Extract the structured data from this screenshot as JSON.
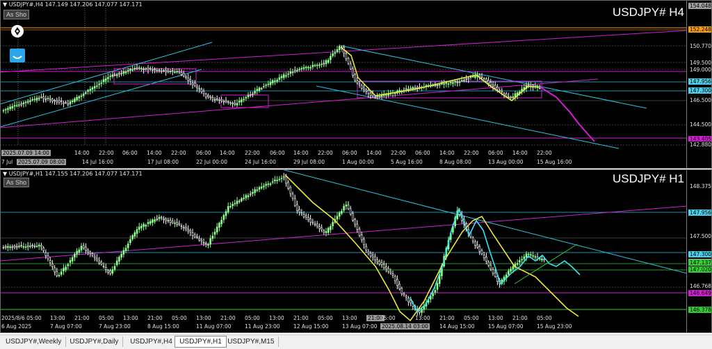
{
  "h4": {
    "menu_glyph": "▼",
    "info": "USDJPY#,H4  147.149 147.206 147.077 147.171",
    "symbol_big": "USDJPY# H4",
    "as_button": "As Sho",
    "prices": [
      {
        "text": "154.048",
        "color": "#a0a0a0",
        "fg": "#000"
      },
      {
        "text": "152.248",
        "color": "#f39c12",
        "fg": "#000"
      },
      {
        "text": "150.770",
        "color": "#000",
        "fg": "#e0e0e0"
      },
      {
        "text": "149.500",
        "color": "#000",
        "fg": "#e0e0e0"
      },
      {
        "text": "149.000",
        "color": "#000",
        "fg": "#e0e0e0"
      },
      {
        "text": "147.956",
        "color": "#48d1e8",
        "fg": "#000"
      },
      {
        "text": "147.300",
        "color": "#48d1e8",
        "fg": "#000"
      },
      {
        "text": "146.500",
        "color": "#000",
        "fg": "#e0e0e0"
      },
      {
        "text": "144.500",
        "color": "#000",
        "fg": "#e0e0e0"
      },
      {
        "text": "143.405",
        "color": "#d21fd2",
        "fg": "#000"
      },
      {
        "text": "142.880",
        "color": "#000",
        "fg": "#e0e0e0"
      }
    ],
    "date_box": "2025.07.09 14:00",
    "times_top": [
      "2025.07.09 14:00",
      "14:00",
      "22:00",
      "06:00",
      "14:00",
      "22:00",
      "06:00",
      "14:00",
      "22:00",
      "06:00",
      "14:00",
      "22:00",
      "06:00",
      "14:00",
      "22:00",
      "06:00",
      "14:00",
      "22:00",
      "06:00",
      "14:00",
      "22:00"
    ],
    "times_bottom": [
      "7 Jul",
      "2025.07.09 08:00",
      "14 Jul 16:00",
      "17 Jul 08:00",
      "22 Jul 00:00",
      "24 Jul 16:00",
      "29 Jul 08:00",
      "1 Aug 00:00",
      "5 Aug 16:00",
      "8 Aug 08:00",
      "13 Aug 00:00",
      "15 Aug 16:00"
    ]
  },
  "h1": {
    "menu_glyph": "▼",
    "info": "USDJPY#,H1  147.155 147.206 147.077 147.171",
    "symbol_big": "USDJPY# H1",
    "as_button": "As Sho",
    "prices": [
      {
        "text": "148.375",
        "color": "#000",
        "fg": "#e0e0e0"
      },
      {
        "text": "147.956",
        "color": "#48d1e8",
        "fg": "#000"
      },
      {
        "text": "147.500",
        "color": "#000",
        "fg": "#e0e0e0"
      },
      {
        "text": "147.300",
        "color": "#48d1e8",
        "fg": "#000"
      },
      {
        "text": "147.171",
        "color": "#a0a0a0",
        "fg": "#000"
      },
      {
        "text": "147.137",
        "color": "#33cc33",
        "fg": "#000"
      },
      {
        "text": "147.020",
        "color": "#33cc33",
        "fg": "#000"
      },
      {
        "text": "146.768",
        "color": "#000",
        "fg": "#e0e0e0"
      },
      {
        "text": "146.649",
        "color": "#d21fd2",
        "fg": "#000"
      },
      {
        "text": "146.378",
        "color": "#33cc33",
        "fg": "#000"
      }
    ],
    "time_boxes": [
      "2025.08.14 09:00",
      "2025.08.14 03:00"
    ],
    "times_top": [
      "2025/8/6 05:00",
      "13:00",
      "21:00",
      "05:00",
      "13:00",
      "21:00",
      "05:00",
      "13:00",
      "21:00",
      "05:00",
      "13:00",
      "21:00",
      "05:00",
      "13:00",
      "21:00",
      "05:00",
      "13:00",
      "21:00",
      "05:00",
      "13:00",
      "21:00",
      "05:00"
    ],
    "times_bottom": [
      "6 Aug 2025",
      "7 Aug 07:00",
      "7 Aug 23:00",
      "8 Aug 15:00",
      "11 Aug 07:00",
      "11 Aug 23:00",
      "12 Aug 15:00",
      "13 Aug 07:00",
      "2025.08.14 03:00",
      "14 Aug 15:00",
      "15 Aug 07:00",
      "15 Aug 23:00"
    ]
  },
  "tabs": [
    {
      "label": "USDJPY#,Weekly",
      "active": false
    },
    {
      "label": "USDJPY#,Daily",
      "active": false
    },
    {
      "label": "USDJPY#,H4",
      "active": false
    },
    {
      "label": "USDJPY#,H1",
      "active": true
    },
    {
      "label": "USDJPY#,M15",
      "active": false
    }
  ],
  "colors": {
    "background": "#000000",
    "bull": "#8cff8c",
    "bear": "#ffffff",
    "trend_cyan": "#29c6e6",
    "trend_magenta": "#d21fd2",
    "zigzag_yellow": "#f2e73a",
    "level_orange": "#f39c12"
  }
}
